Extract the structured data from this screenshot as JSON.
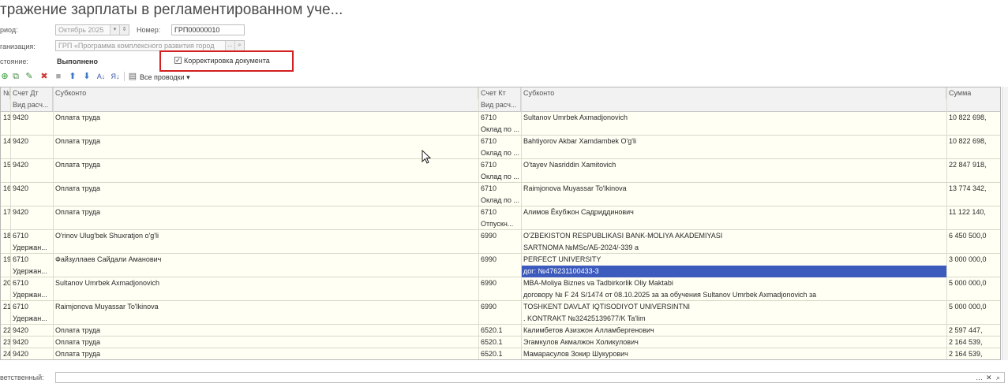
{
  "window": {
    "title": "тражение зарплаты в регламентированном уче..."
  },
  "form": {
    "period_label": "риод:",
    "period_value": "Октябрь 2025",
    "number_label": "Номер:",
    "number_value": "ГРП00000010",
    "org_label": "ганизация:",
    "org_value": "ГРП «Программа комплексного развития город",
    "state_label": "стояние:",
    "state_value": "Выполнено",
    "correction_label": "Корректировка документа",
    "correction_checked": true
  },
  "toolbar": {
    "all_postings_label": "Все проводки"
  },
  "table": {
    "headers": {
      "num": "№",
      "schet_dt": "Счет Дт",
      "vid_rasch": "Вид расч...",
      "subkonto_dt": "Субконто",
      "schet_kt": "Счет Кт",
      "vid_rasch_kt": "Вид расч...",
      "subkonto_kt": "Субконто",
      "summa": "Сумма"
    },
    "rows": [
      {
        "n": "13",
        "dt": "9420",
        "dt2": "",
        "sub_dt": "Оплата труда",
        "kt": "6710",
        "kt2": "Оклад по ...",
        "sub_kt": "Sultanov Umrbek Axmadjonovich",
        "sub_kt2": "",
        "sum": "10 822 698,"
      },
      {
        "n": "14",
        "dt": "9420",
        "dt2": "",
        "sub_dt": "Оплата труда",
        "kt": "6710",
        "kt2": "Оклад по ...",
        "sub_kt": "Bahtiyorov Akbar Xamdambek O'g'li",
        "sub_kt2": "",
        "sum": "10 822 698,"
      },
      {
        "n": "15",
        "dt": "9420",
        "dt2": "",
        "sub_dt": "Оплата труда",
        "kt": "6710",
        "kt2": "Оклад по ...",
        "sub_kt": "O'tayev Nasriddin Xamitovich",
        "sub_kt2": "",
        "sum": "22 847 918,"
      },
      {
        "n": "16",
        "dt": "9420",
        "dt2": "",
        "sub_dt": "Оплата труда",
        "kt": "6710",
        "kt2": "Оклад по ...",
        "sub_kt": "Raimjonova Muyassar To'lkinova",
        "sub_kt2": "",
        "sum": "13 774 342,"
      },
      {
        "n": "17",
        "dt": "9420",
        "dt2": "",
        "sub_dt": "Оплата труда",
        "kt": "6710",
        "kt2": "Отпускн...",
        "sub_kt": "Алимов Ёкубжон Садриддинович",
        "sub_kt2": "",
        "sum": "11 122 140,"
      },
      {
        "n": "18",
        "dt": "6710",
        "dt2": "Удержан...",
        "sub_dt": "O'rinov Ulug'bek Shuxratjon o'g'li",
        "kt": "6990",
        "kt2": "",
        "sub_kt": "O'ZBEKISTON RESPUBLIKASI BANK-MOLIYA AKADEMIYASI",
        "sub_kt2": "SARTNOMA №MSc/AБ-2024/-339 a",
        "sum": "6 450 500,0"
      },
      {
        "n": "19",
        "dt": "6710",
        "dt2": "Удержан...",
        "sub_dt": "Файзуллаев Сайдали Аманович",
        "kt": "6990",
        "kt2": "",
        "sub_kt": "PERFECT UNIVERSITY",
        "sub_kt2": "дог: №476231100433-3",
        "sum": "3 000 000,0"
      },
      {
        "n": "20",
        "dt": "6710",
        "dt2": "Удержан...",
        "sub_dt": "Sultanov Umrbek Axmadjonovich",
        "kt": "6990",
        "kt2": "",
        "sub_kt": "MBA-Moliya  Biznes va Tadbirkorlik Oliy Maktabi",
        "sub_kt2": " договору № F 24 S/1474 от 08.10.2025 за  за обучения Sultanov Umrbek Axmadjonovich за",
        "sum": "5 000 000,0"
      },
      {
        "n": "21",
        "dt": "6710",
        "dt2": "Удержан...",
        "sub_dt": "Raimjonova Muyassar To'lkinova",
        "kt": "6990",
        "kt2": "",
        "sub_kt": "TOSHKENT DAVLAT IQTISODIYOT UNIVERSINTNI",
        "sub_kt2": " .  KONTRAKT №32425139677/K  Ta'lim",
        "sum": "5 000 000,0"
      },
      {
        "n": "22",
        "dt": "9420",
        "dt2": "",
        "sub_dt": "Оплата труда",
        "kt": "6520.1",
        "kt2": "",
        "sub_kt": "Калимбетов Азизжон Алламбергенович",
        "sub_kt2": "",
        "sum": "2 597 447,"
      },
      {
        "n": "23",
        "dt": "9420",
        "dt2": "",
        "sub_dt": "Оплата труда",
        "kt": "6520.1",
        "kt2": "",
        "sub_kt": "Эгамкулов Акмалжон Холикулович",
        "sub_kt2": "",
        "sum": "2 164 539,"
      },
      {
        "n": "24",
        "dt": "9420",
        "dt2": "",
        "sub_dt": "Оплата труда",
        "kt": "6520.1",
        "kt2": "",
        "sub_kt": "Мамарасулов Зокир Шукурович",
        "sub_kt2": "",
        "sum": "2 164 539,"
      }
    ]
  },
  "footer": {
    "responsible_label": "ветственный:"
  }
}
